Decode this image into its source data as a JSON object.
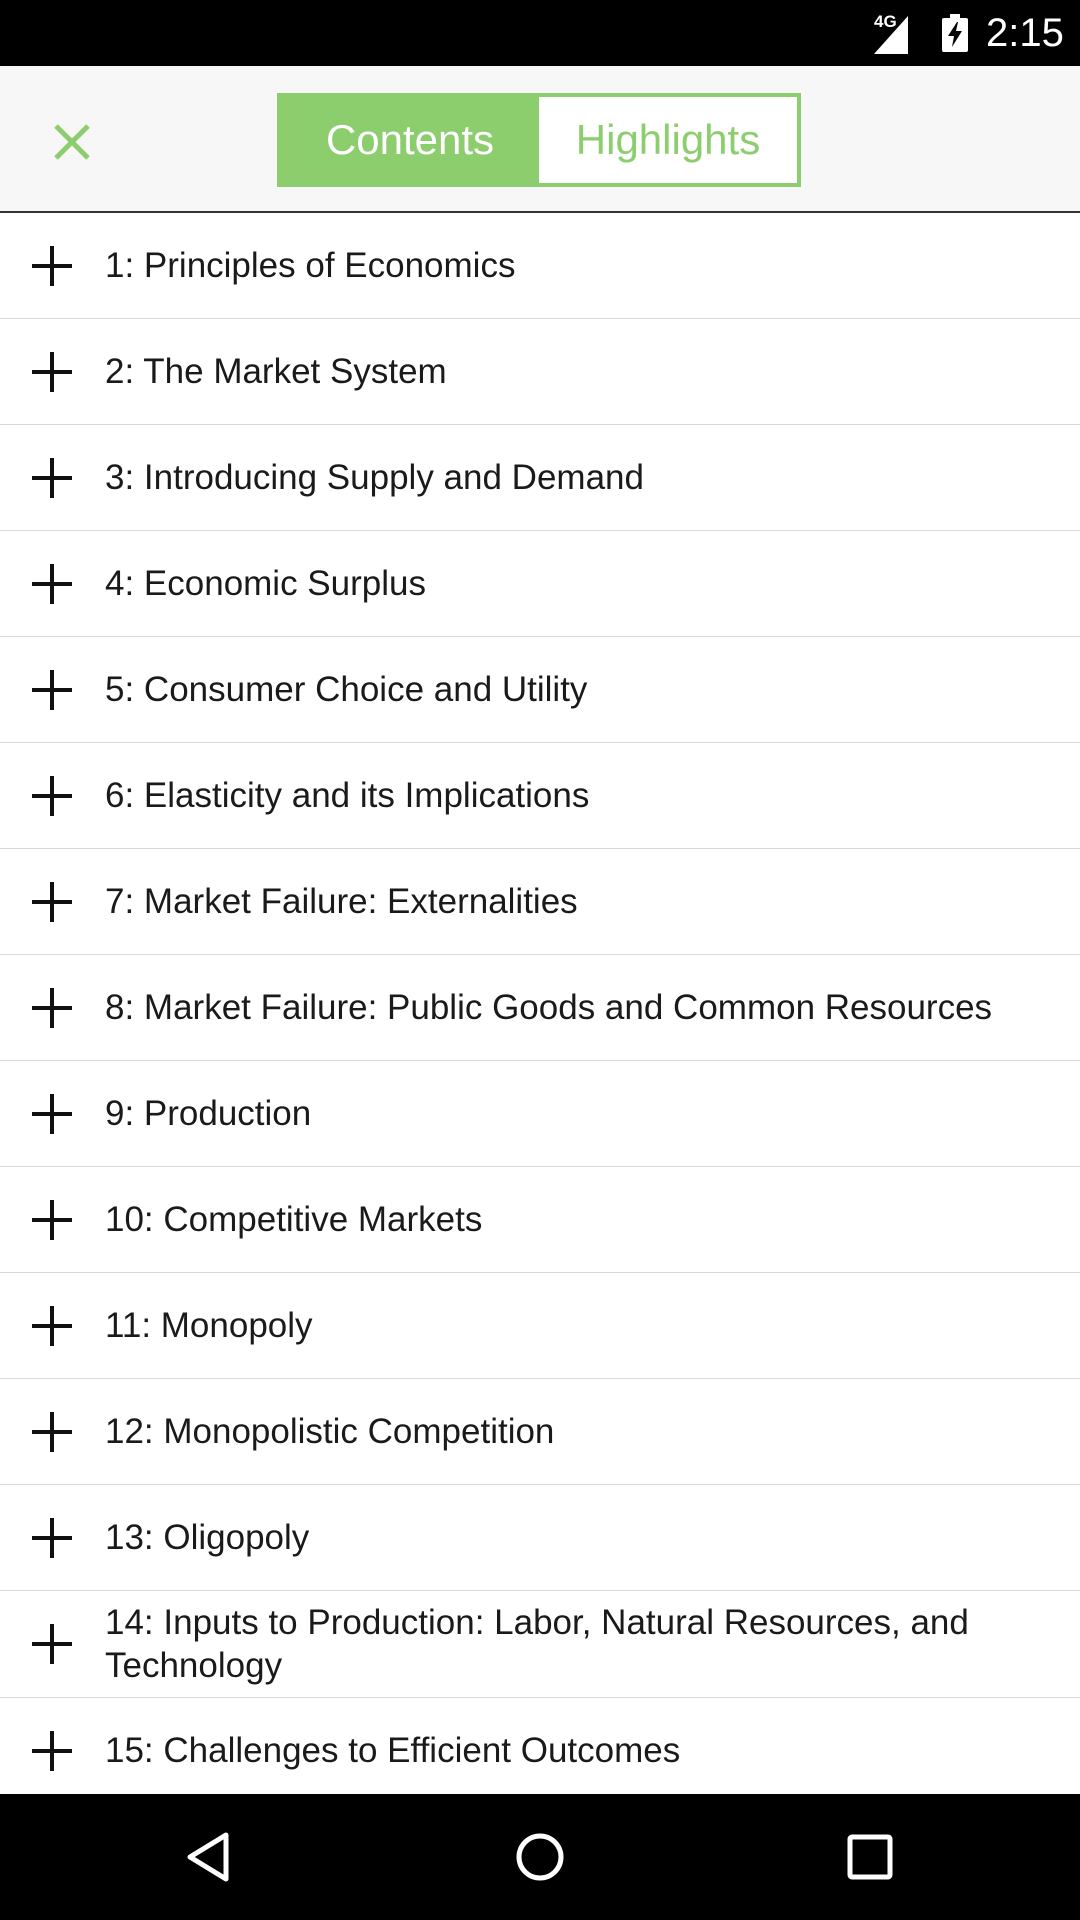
{
  "status_bar": {
    "network": "4G",
    "time": "2:15",
    "icons": [
      "signal-icon",
      "battery-charging-icon"
    ]
  },
  "toolbar": {
    "close_icon": "close-icon",
    "tabs": [
      {
        "label": "Contents",
        "active": true
      },
      {
        "label": "Highlights",
        "active": false
      }
    ],
    "accent_color": "#8ccd6e"
  },
  "toc": {
    "expand_icon": "plus-icon",
    "items": [
      {
        "label": "1: Principles of Economics"
      },
      {
        "label": "2: The Market System"
      },
      {
        "label": "3: Introducing Supply and Demand"
      },
      {
        "label": "4: Economic Surplus"
      },
      {
        "label": "5: Consumer Choice and Utility"
      },
      {
        "label": "6: Elasticity and its Implications"
      },
      {
        "label": "7: Market Failure: Externalities"
      },
      {
        "label": "8: Market Failure: Public Goods and Common Resources"
      },
      {
        "label": "9: Production"
      },
      {
        "label": "10: Competitive Markets"
      },
      {
        "label": "11: Monopoly"
      },
      {
        "label": "12: Monopolistic Competition"
      },
      {
        "label": "13: Oligopoly"
      },
      {
        "label": "14: Inputs to Production: Labor, Natural Resources, and Technology"
      },
      {
        "label": "15: Challenges to Efficient Outcomes"
      }
    ]
  },
  "nav_bar": {
    "icons": [
      "back-icon",
      "home-icon",
      "recents-icon"
    ]
  }
}
